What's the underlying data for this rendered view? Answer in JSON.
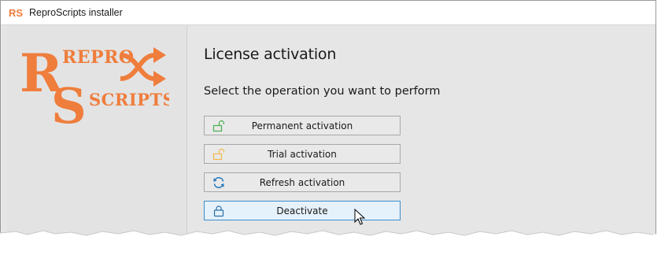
{
  "window": {
    "title": "ReproScripts installer"
  },
  "app_icon": {
    "letters": "RS",
    "color": "#ef7d3c"
  },
  "logo": {
    "line1": "REPRO",
    "line2": "SCRIPTS",
    "big_r": "R",
    "big_s": "S",
    "color": "#ef7d3c"
  },
  "page": {
    "heading": "License activation",
    "subheading": "Select the operation you want to perform"
  },
  "buttons": [
    {
      "label": "Permanent activation",
      "icon": "unlock-icon",
      "icon_color": "#4caf50"
    },
    {
      "label": "Trial activation",
      "icon": "unlock-icon",
      "icon_color": "#f2b84b"
    },
    {
      "label": "Refresh activation",
      "icon": "refresh-icon",
      "icon_color": "#2b7bbf"
    },
    {
      "label": "Deactivate",
      "icon": "lock-icon",
      "icon_color": "#2b6fa8"
    }
  ]
}
